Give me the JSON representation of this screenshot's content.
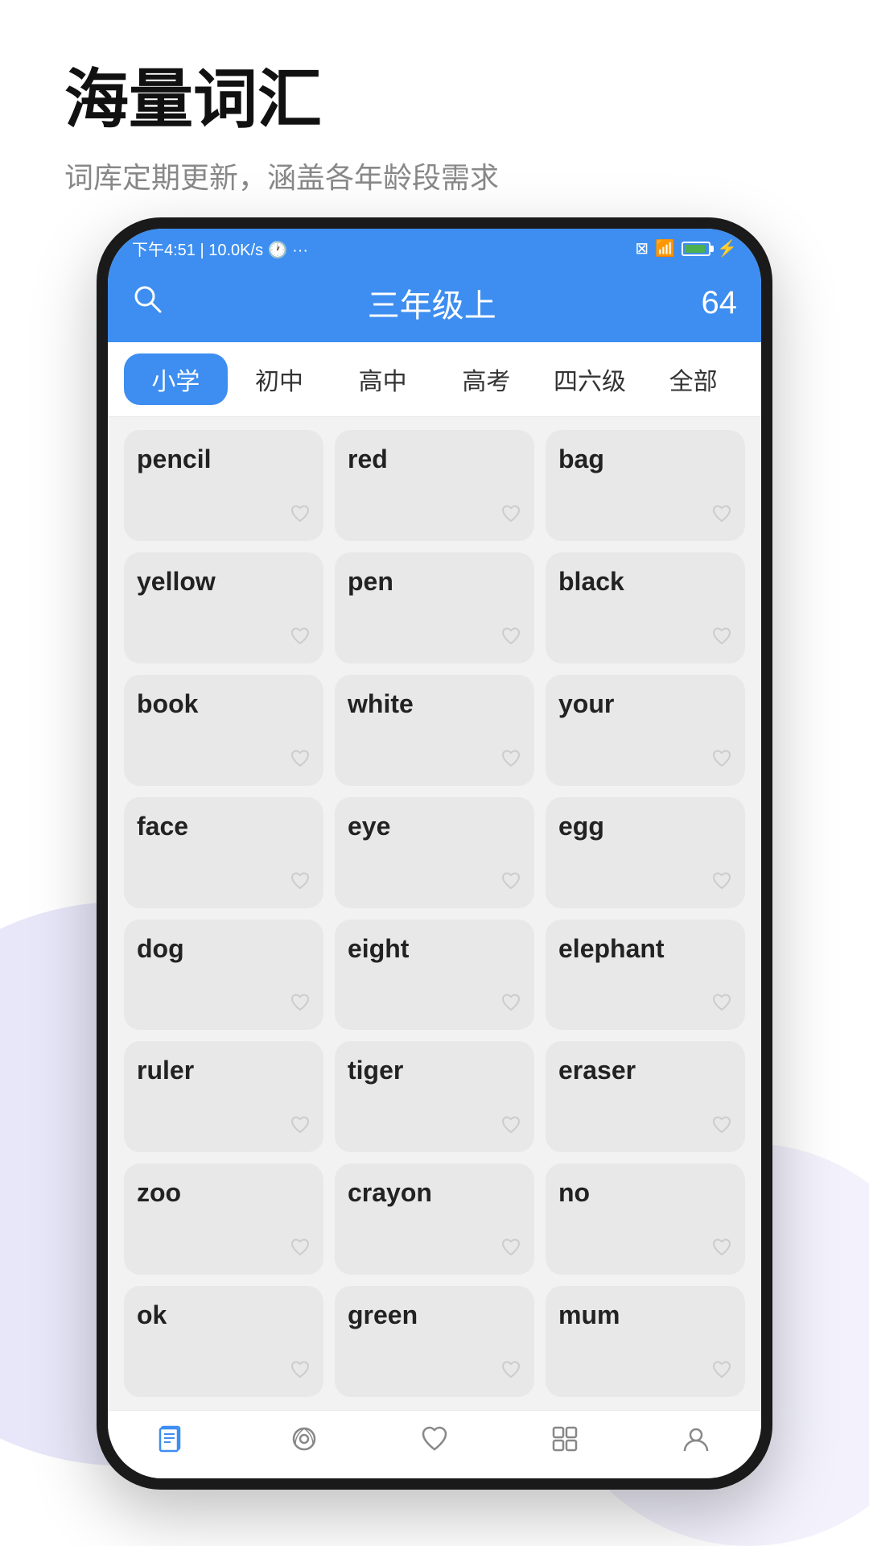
{
  "page": {
    "title": "海量词汇",
    "subtitle": "词库定期更新，涵盖各年龄段需求"
  },
  "statusBar": {
    "time": "下午4:51",
    "network": "10.0K/s",
    "icons": "⊠ ☁ 100"
  },
  "appHeader": {
    "title": "三年级上",
    "wordCount": "64",
    "searchIcon": "⌕"
  },
  "tabs": [
    {
      "label": "小学",
      "active": true
    },
    {
      "label": "初中",
      "active": false
    },
    {
      "label": "高中",
      "active": false
    },
    {
      "label": "高考",
      "active": false
    },
    {
      "label": "四六级",
      "active": false
    },
    {
      "label": "全部",
      "active": false
    }
  ],
  "words": [
    "pencil",
    "red",
    "bag",
    "yellow",
    "pen",
    "black",
    "book",
    "white",
    "your",
    "face",
    "eye",
    "egg",
    "dog",
    "eight",
    "elephant",
    "ruler",
    "tiger",
    "eraser",
    "zoo",
    "crayon",
    "no",
    "ok",
    "green",
    "mum"
  ],
  "bottomNav": [
    {
      "icon": "📖",
      "label": ""
    },
    {
      "icon": "🎧",
      "label": ""
    },
    {
      "icon": "♡",
      "label": ""
    },
    {
      "icon": "🔲",
      "label": ""
    },
    {
      "icon": "👤",
      "label": ""
    }
  ]
}
